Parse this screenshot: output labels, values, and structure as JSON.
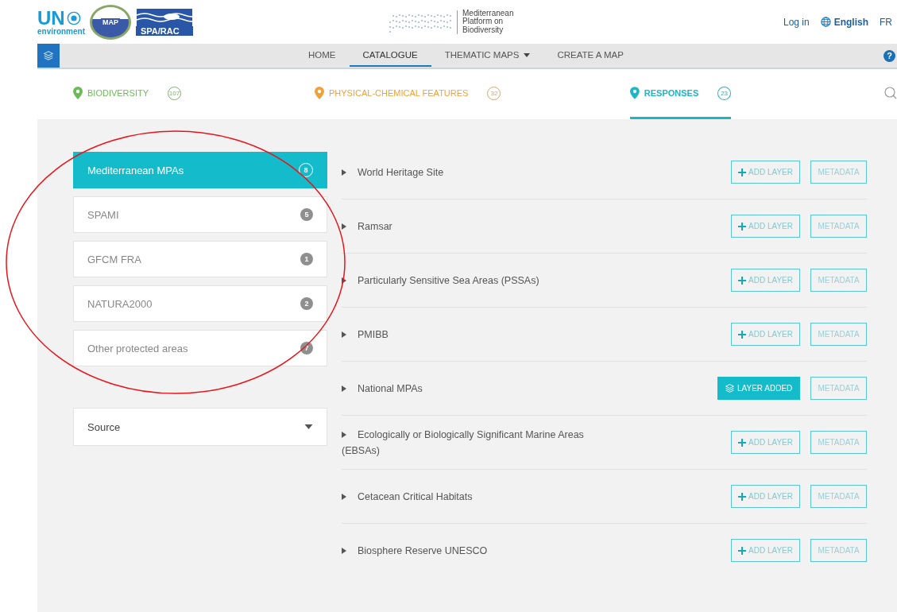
{
  "header": {
    "un_logo": {
      "title": "UN",
      "subtitle": "environment"
    },
    "map_emblem": "MAP",
    "spa_logo": "SPA/RAC",
    "site_name": [
      "Mediterranean",
      "Platform on",
      "Biodiversity"
    ],
    "login": "Log in",
    "language": "English",
    "alt_language": "FR"
  },
  "nav": [
    {
      "label": "HOME",
      "selected": false,
      "dropdown": false
    },
    {
      "label": "CATALOGUE",
      "selected": true,
      "dropdown": false
    },
    {
      "label": "THEMATIC MAPS",
      "selected": false,
      "dropdown": true
    },
    {
      "label": "CREATE A MAP",
      "selected": false,
      "dropdown": false
    }
  ],
  "help": "?",
  "categories": [
    {
      "label": "BIODIVERSITY",
      "count": "107",
      "color": "#6dbb58",
      "selected": false
    },
    {
      "label": "PHYSICAL-CHEMICAL FEATURES",
      "count": "32",
      "color": "#efa23a",
      "selected": false
    },
    {
      "label": "RESPONSES",
      "count": "23",
      "color": "#1cb6c6",
      "selected": true
    }
  ],
  "filters": [
    {
      "label": "Mediterranean MPAs",
      "count": "8",
      "selected": true
    },
    {
      "label": "SPAMI",
      "count": "5",
      "selected": false
    },
    {
      "label": "GFCM FRA",
      "count": "1",
      "selected": false
    },
    {
      "label": "NATURA2000",
      "count": "2",
      "selected": false
    },
    {
      "label": "Other protected areas",
      "count": "7",
      "selected": false
    }
  ],
  "source": {
    "label": "Source"
  },
  "layers": [
    {
      "title": "World Heritage Site",
      "added": false,
      "button": "ADD LAYER",
      "metadata": "METADATA"
    },
    {
      "title": "Ramsar",
      "added": false,
      "button": "ADD LAYER",
      "metadata": "METADATA"
    },
    {
      "title": "Particularly Sensitive Sea Areas (PSSAs)",
      "added": false,
      "button": "ADD LAYER",
      "metadata": "METADATA"
    },
    {
      "title": "PMIBB",
      "added": false,
      "button": "ADD LAYER",
      "metadata": "METADATA"
    },
    {
      "title": "National MPAs",
      "added": true,
      "button": "LAYER ADDED",
      "metadata": "METADATA"
    },
    {
      "title": "Ecologically or Biologically Significant Marine Areas (EBSAs)",
      "added": false,
      "button": "ADD LAYER",
      "metadata": "METADATA"
    },
    {
      "title": "Cetacean Critical Habitats",
      "added": false,
      "button": "ADD LAYER",
      "metadata": "METADATA"
    },
    {
      "title": "Biosphere Reserve UNESCO",
      "added": false,
      "button": "ADD LAYER",
      "metadata": "METADATA"
    }
  ],
  "annotation": {
    "kind": "ellipse"
  }
}
